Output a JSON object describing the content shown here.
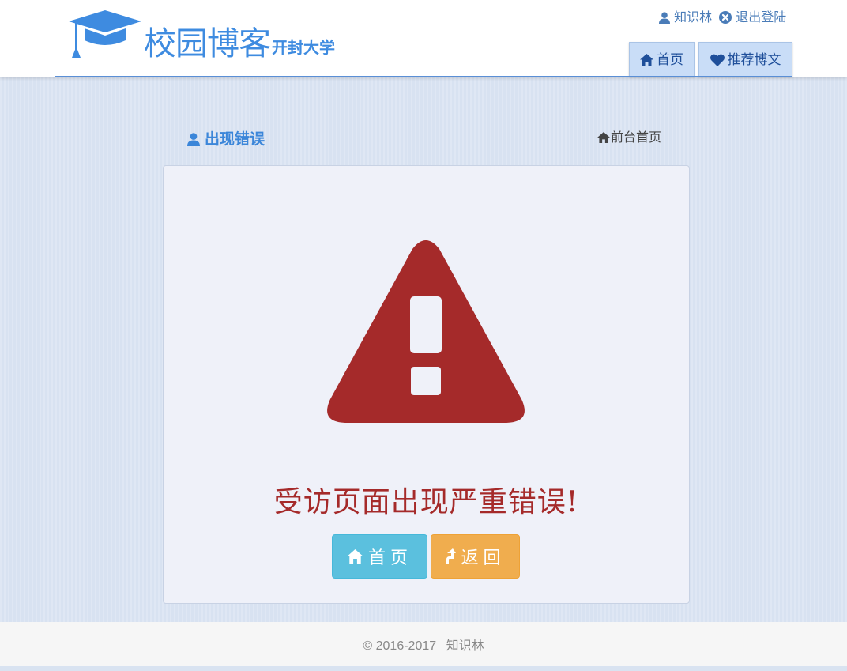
{
  "header": {
    "logo_title": "校园博客",
    "logo_subtitle": "开封大学",
    "user_name": "知识林",
    "logout_label": "退出登陆",
    "nav": [
      {
        "label": "首页",
        "icon": "home-icon"
      },
      {
        "label": "推荐博文",
        "icon": "heart-icon"
      }
    ]
  },
  "main": {
    "section_title": "出现错误",
    "front_link": "前台首页",
    "error_message": "受访页面出现严重错误!",
    "buttons": {
      "home_label": "首页",
      "back_label": "返回"
    }
  },
  "footer": {
    "copyright": "© 2016-2017",
    "author": "知识林"
  },
  "colors": {
    "brand_blue": "#3e8be0",
    "nav_bg": "#c9ddf7",
    "error_red": "#a52a2a",
    "info_button": "#5bc0de",
    "warning_button": "#f0ad4e"
  }
}
